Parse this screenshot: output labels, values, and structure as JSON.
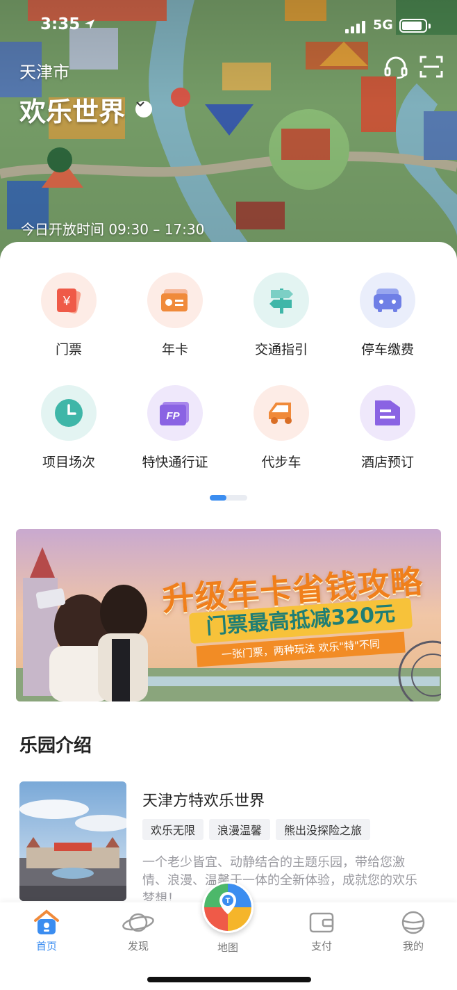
{
  "status_bar": {
    "time": "3:35",
    "network": "5G"
  },
  "header": {
    "city": "天津市",
    "park_name": "欢乐世界",
    "hours_label": "今日开放时间",
    "hours_value": "09:30 – 17:30"
  },
  "services": [
    {
      "label": "门票",
      "icon": "ticket-icon",
      "bg": "#fdece6"
    },
    {
      "label": "年卡",
      "icon": "annual-card-icon",
      "bg": "#fdece6"
    },
    {
      "label": "交通指引",
      "icon": "signpost-icon",
      "bg": "#e3f4f2"
    },
    {
      "label": "停车缴费",
      "icon": "car-icon",
      "bg": "#eaeefb"
    },
    {
      "label": "项目场次",
      "icon": "clock-icon",
      "bg": "#e3f4f2"
    },
    {
      "label": "特快通行证",
      "icon": "fastpass-icon",
      "bg": "#efe8fb"
    },
    {
      "label": "代步车",
      "icon": "cart-icon",
      "bg": "#fdece6"
    },
    {
      "label": "酒店预订",
      "icon": "hotel-icon",
      "bg": "#efe8fb"
    }
  ],
  "pager": {
    "pages": 2,
    "current": 1
  },
  "banner": {
    "headline": "升级年卡省钱攻略",
    "subline": "门票最高抵减320元",
    "tagline": "一张门票，两种玩法 欢乐\"特\"不同"
  },
  "intro_section": {
    "title": "乐园介绍",
    "park_title": "天津方特欢乐世界",
    "tags": [
      "欢乐无限",
      "浪漫温馨",
      "熊出没探险之旅"
    ],
    "description": "一个老少皆宜、动静结合的主题乐园，带给您激情、浪漫、温馨于一体的全新体验，成就您的欢乐梦想！"
  },
  "tab_bar": {
    "items": [
      "首页",
      "发现",
      "地图",
      "支付",
      "我的"
    ],
    "active": "首页"
  },
  "colors": {
    "accent": "#3b8df0",
    "banner_orange": "#f07f1b"
  }
}
